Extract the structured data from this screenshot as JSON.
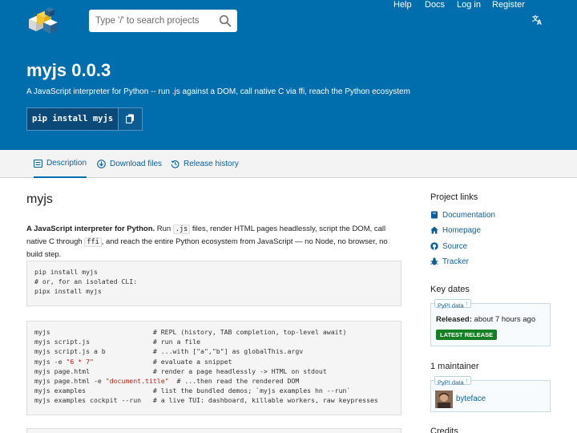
{
  "nav": {
    "search_placeholder": "Type '/' to search projects",
    "links": [
      "Help",
      "Docs",
      "Log in",
      "Register"
    ],
    "language_icon": "translate-icon"
  },
  "colors": {
    "brand": "#006dad",
    "tabs_bg": "#f3f3f3",
    "link": "#0b5f9a",
    "release_badge": "#148024"
  },
  "package": {
    "title": "myjs 0.0.3",
    "summary": "A JavaScript interpreter for Python -- run .js against a DOM, call native C via ffi, reach the Python ecosystem",
    "pip_command": "pip install myjs"
  },
  "tabs": [
    {
      "label": "Description",
      "icon": "list-icon",
      "active": true
    },
    {
      "label": "Download files",
      "icon": "download-icon",
      "active": false
    },
    {
      "label": "Release history",
      "icon": "history-icon",
      "active": false
    }
  ],
  "main": {
    "heading": "myjs",
    "intro": {
      "bold": "A JavaScript interpreter for Python.",
      "t1": " Run ",
      "c1": ".js",
      "t2": " files, render HTML pages headlessly, script the DOM, call native C through ",
      "c2": "ffi",
      "t3": ", and reach the entire Python ecosystem from JavaScript — no Node, no browser, no build step."
    },
    "install_lines": [
      "pip install myjs",
      "# or, for an isolated CLI:",
      "pipx install myjs"
    ],
    "usage_lines": [
      {
        "cmd": "myjs",
        "comment": "# REPL (history, TAB completion, top-level await)"
      },
      {
        "cmd": "myjs script.js",
        "comment": "# run a file"
      },
      {
        "cmd": "myjs script.js a b",
        "comment": "# ...with [\"a\",\"b\"] as globalThis.argv"
      },
      {
        "cmd": "myjs -e ",
        "str": "\"6 * 7\"",
        "comment": "# evaluate a snippet"
      },
      {
        "cmd": "myjs page.html",
        "comment": "# render a page headlessly -> HTML on stdout"
      },
      {
        "cmd": "myjs page.html -e ",
        "str": "\"document.title\"",
        "comment": "# ...then read the rendered DOM"
      },
      {
        "cmd": "myjs examples",
        "comment": "# list the bundled demos; `myjs examples hn --run`"
      },
      {
        "cmd": "myjs examples cockpit --run",
        "comment": "# a live TUI: dashboard, killable workers, raw keypresses"
      }
    ]
  },
  "sidebar": {
    "project_links_heading": "Project links",
    "project_links": [
      {
        "label": "Documentation",
        "icon": "book-icon"
      },
      {
        "label": "Homepage",
        "icon": "home-icon"
      },
      {
        "label": "Source",
        "icon": "github-icon"
      },
      {
        "label": "Tracker",
        "icon": "bug-icon"
      }
    ],
    "key_dates_heading": "Key dates",
    "pypi_data_label": "PyPI data",
    "pypi_data_sup": "↑",
    "released_label": "Released:",
    "released_value": "about 7 hours ago",
    "latest_badge": "LATEST RELEASE",
    "maintainer_heading": "1 maintainer",
    "maintainer_name": "byteface",
    "next_heading": "Credits"
  }
}
